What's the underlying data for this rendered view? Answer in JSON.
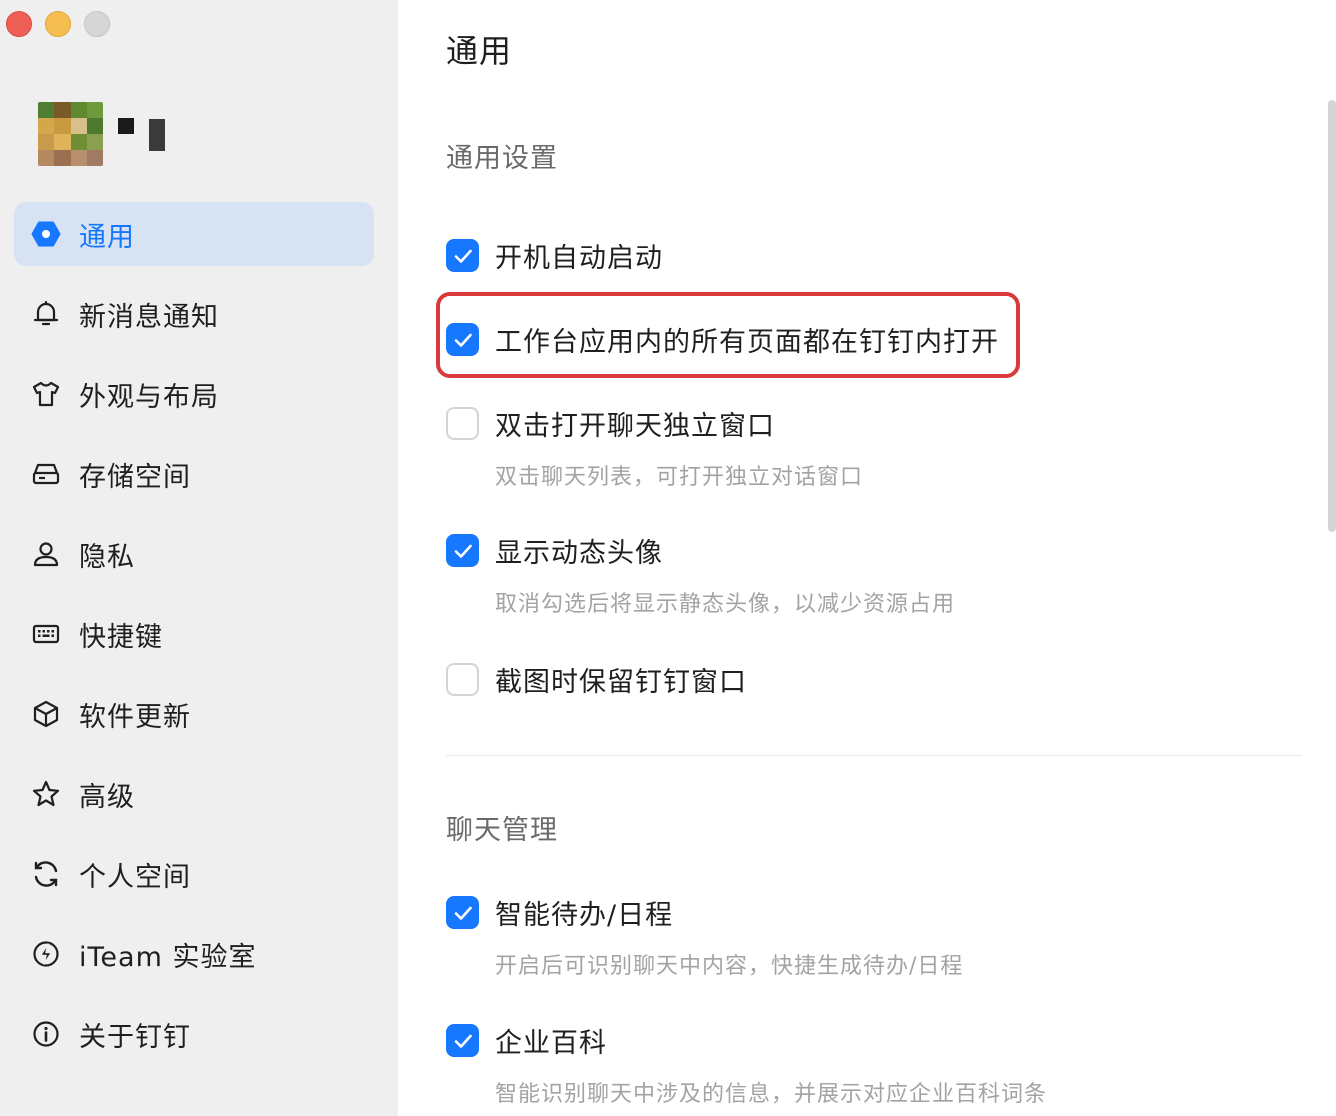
{
  "sidebar": {
    "items": [
      {
        "label": "通用",
        "icon": "settings-hexagon-icon",
        "active": true
      },
      {
        "label": "新消息通知",
        "icon": "bell-icon"
      },
      {
        "label": "外观与布局",
        "icon": "shirt-icon"
      },
      {
        "label": "存储空间",
        "icon": "storage-drive-icon"
      },
      {
        "label": "隐私",
        "icon": "person-icon"
      },
      {
        "label": "快捷键",
        "icon": "keyboard-icon"
      },
      {
        "label": "软件更新",
        "icon": "cube-icon"
      },
      {
        "label": "高级",
        "icon": "star-icon"
      },
      {
        "label": "个人空间",
        "icon": "refresh-circle-icon"
      },
      {
        "label": "iTeam 实验室",
        "icon": "lightning-circle-icon"
      },
      {
        "label": "关于钉钉",
        "icon": "info-circle-icon"
      }
    ]
  },
  "main": {
    "title": "通用",
    "sections": [
      {
        "title": "通用设置",
        "options": [
          {
            "label": "开机自动启动",
            "checked": true
          },
          {
            "label": "工作台应用内的所有页面都在钉钉内打开",
            "checked": true,
            "highlighted": true
          },
          {
            "label": "双击打开聊天独立窗口",
            "checked": false,
            "desc": "双击聊天列表，可打开独立对话窗口"
          },
          {
            "label": "显示动态头像",
            "checked": true,
            "desc": "取消勾选后将显示静态头像，以减少资源占用"
          },
          {
            "label": "截图时保留钉钉窗口",
            "checked": false
          }
        ]
      },
      {
        "title": "聊天管理",
        "options": [
          {
            "label": "智能待办/日程",
            "checked": true,
            "desc": "开启后可识别聊天中内容，快捷生成待办/日程"
          },
          {
            "label": "企业百科",
            "checked": true,
            "desc": "智能识别聊天中涉及的信息，并展示对应企业百科词条"
          }
        ]
      }
    ]
  },
  "colors": {
    "accent": "#1677ff",
    "active_bg": "#d7e3f3",
    "sidebar_bg": "#efeff0",
    "highlight": "#d8393a"
  }
}
